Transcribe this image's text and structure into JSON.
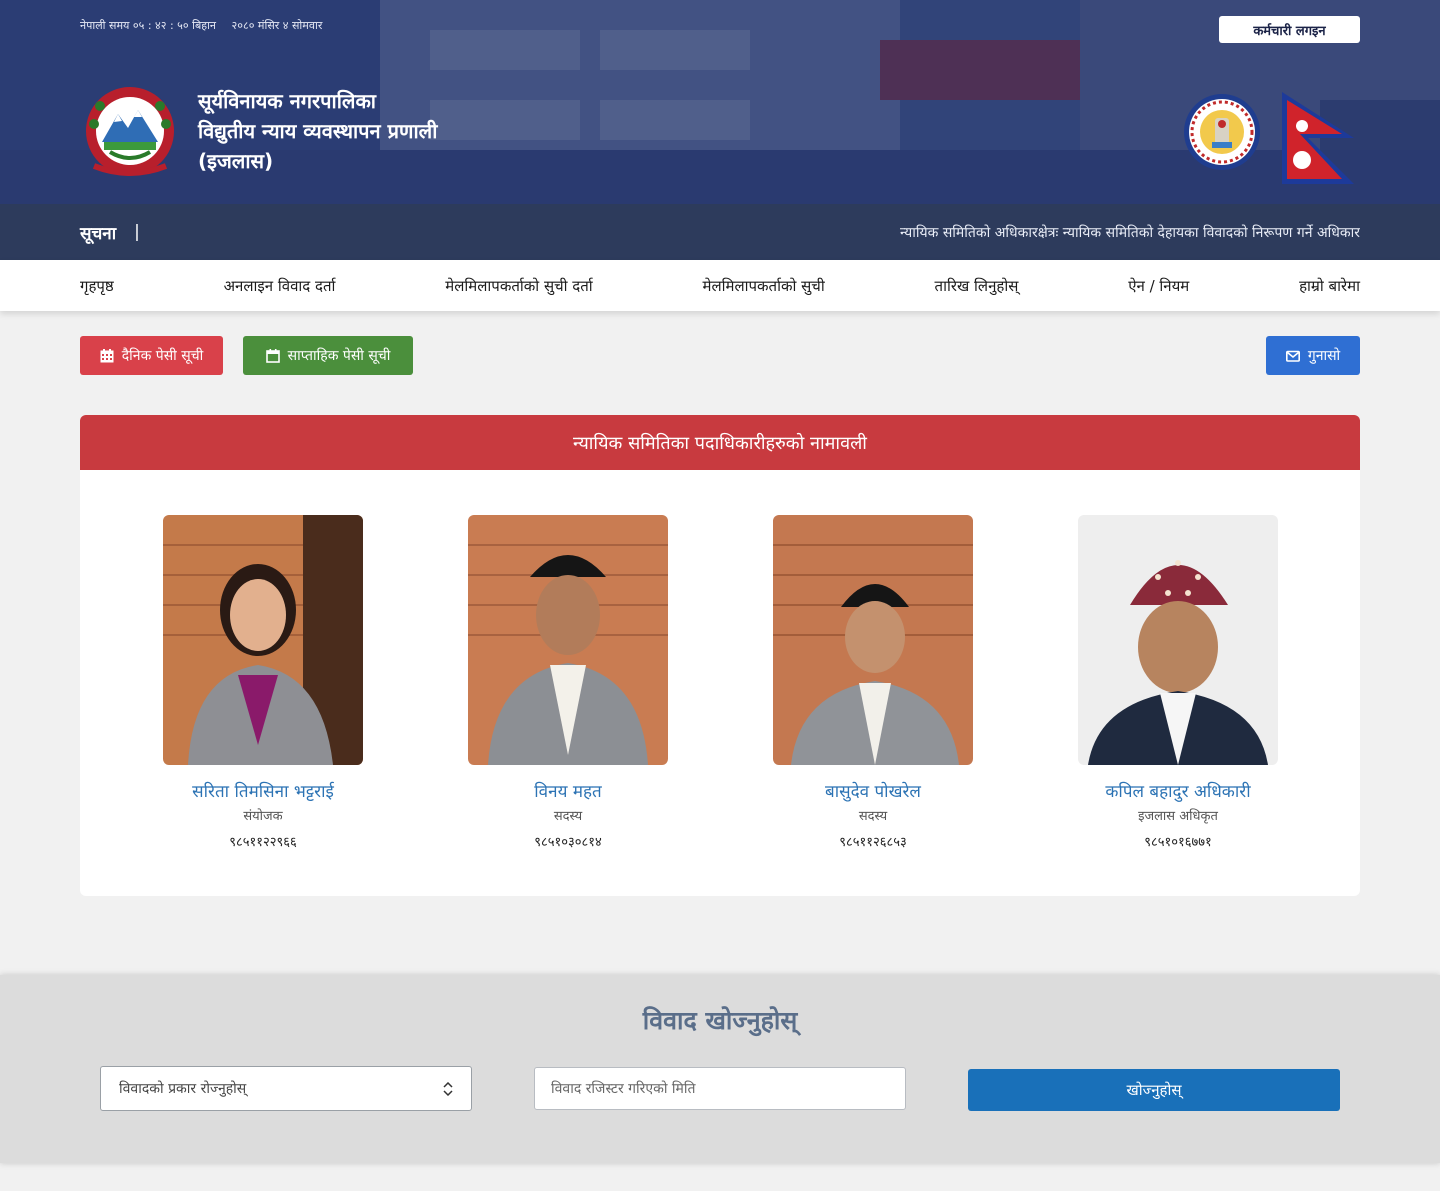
{
  "header": {
    "time_label": "नेपाली समय ०५ : ४२ : ५० बिहान",
    "date_label": "२०८० मंसिर ४ सोमवार",
    "login_label": "कर्मचारी लगइन",
    "title_line1": "सूर्यविनायक नगरपालिका",
    "title_line2": "विद्युतीय न्याय व्यवस्थापन प्रणाली",
    "title_line3": "(इजलास)"
  },
  "notice": {
    "label": "सूचना",
    "separator": "|",
    "ticker": "न्यायिक समितिको अधिकारक्षेत्रः न्यायिक समितिको देहायका विवादको निरूपण गर्ने अधिकार"
  },
  "nav": {
    "items": [
      "गृहपृष्ठ",
      "अनलाइन विवाद दर्ता",
      "मेलमिलापकर्ताको सुची दर्ता",
      "मेलमिलापकर्ताको सुची",
      "तारिख लिनुहोस्",
      "ऐन / नियम",
      "हाम्रो बारेमा"
    ]
  },
  "actions": {
    "daily_label": "दैनिक पेसी सूची",
    "weekly_label": "साप्ताहिक पेसी सूची",
    "feedback_label": "गुनासो"
  },
  "officials": {
    "heading": "न्यायिक समितिका पदाधिकारीहरुको नामावली",
    "people": [
      {
        "name": "सरिता तिमसिना भट्टराई",
        "role": "संयोजक",
        "phone": "९८५११२२९६६"
      },
      {
        "name": "विनय महत",
        "role": "सदस्य",
        "phone": "९८५१०३०८१४"
      },
      {
        "name": "बासुदेव पोखरेल",
        "role": "सदस्य",
        "phone": "९८५११२६८५३"
      },
      {
        "name": "कपिल बहादुर अधिकारी",
        "role": "इजलास अधिकृत",
        "phone": "९८५१०१६७७१"
      }
    ]
  },
  "search": {
    "title": "विवाद खोज्नुहोस्",
    "type_select_value": "विवादको प्रकार रोज्नुहोस्",
    "date_placeholder": "विवाद रजिस्टर गरिएको मिति",
    "button_label": "खोज्नुहोस्"
  },
  "colors": {
    "header_overlay": "#2c3e78",
    "notice_bar": "#2d3b5c",
    "daily_button": "#d9414a",
    "weekly_button": "#4b8f3c",
    "feedback_button": "#2f6fd3",
    "officials_header": "#c83a3f",
    "person_name": "#2c73b4",
    "search_button": "#1970b9"
  },
  "icons": {
    "daily": "calendar-grid-icon",
    "weekly": "calendar-icon",
    "feedback": "envelope-icon"
  }
}
